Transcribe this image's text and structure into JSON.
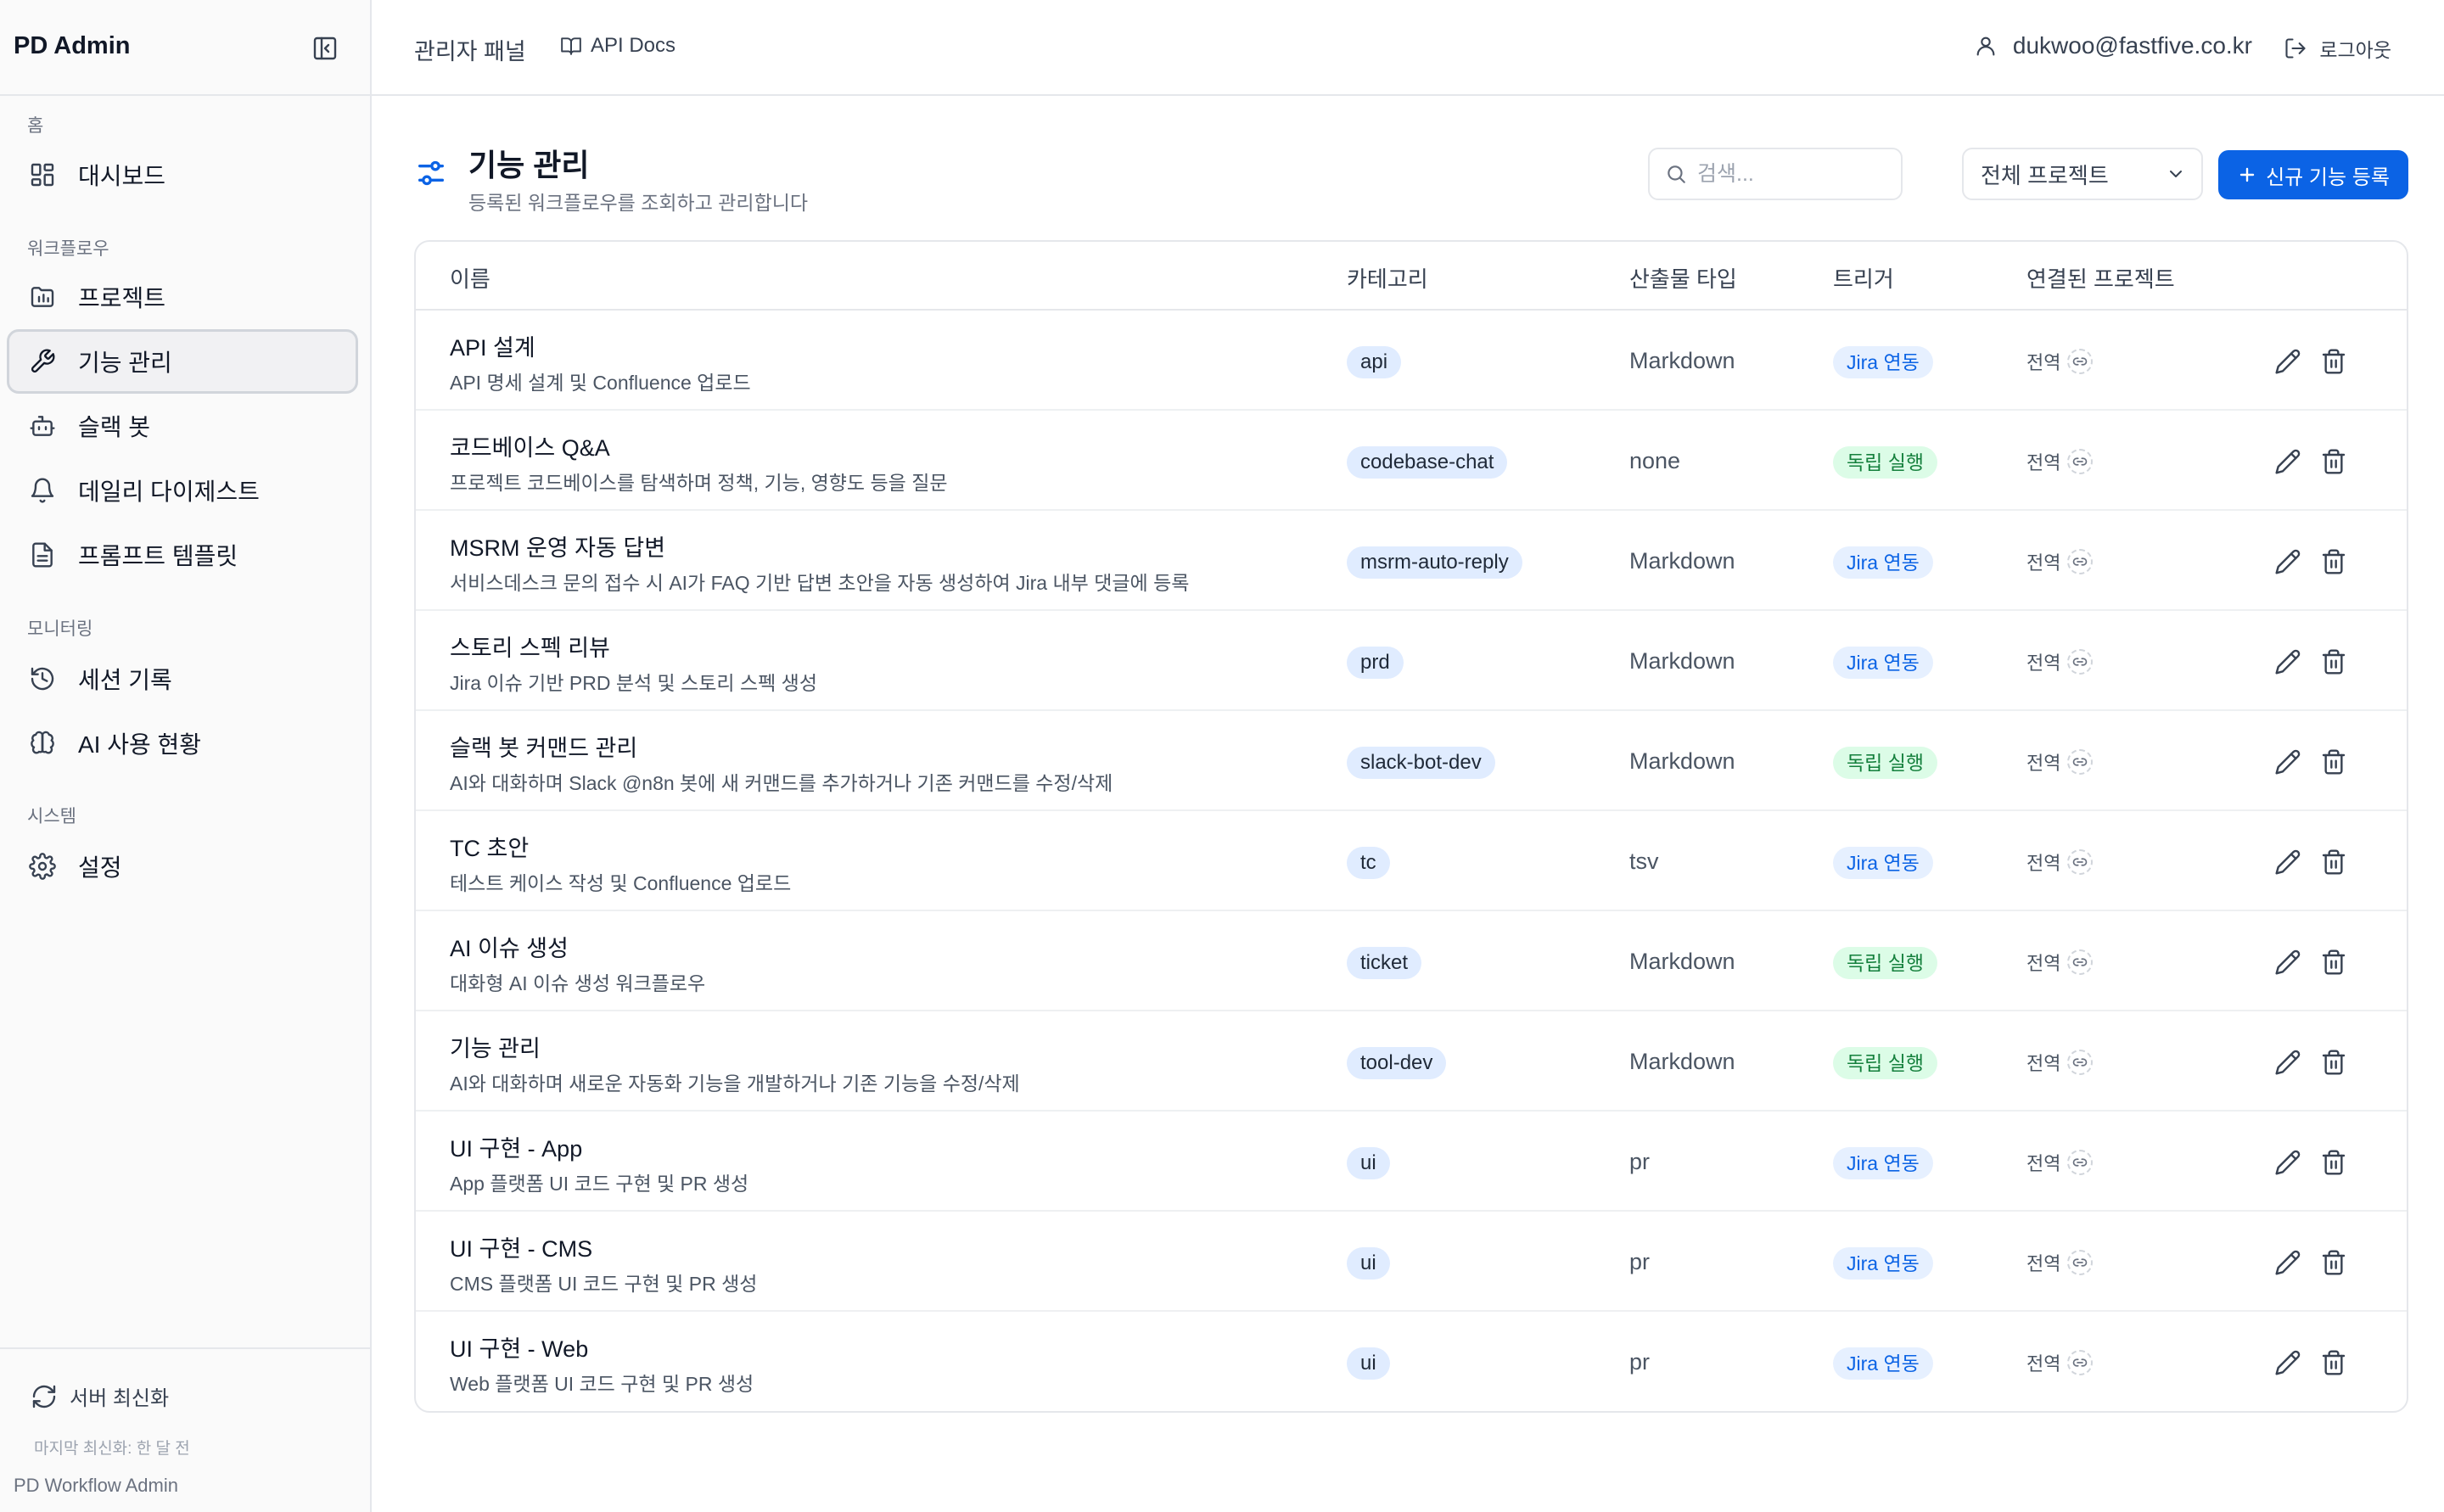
{
  "app": {
    "brand": "PD Admin",
    "footer_note": "PD Workflow Admin"
  },
  "topbar": {
    "admin_panel": "관리자 패널",
    "api_docs": "API Docs",
    "user_email": "dukwoo@fastfive.co.kr",
    "logout": "로그아웃"
  },
  "sidebar": {
    "sections": {
      "home": "홈",
      "workflow": "워크플로우",
      "monitoring": "모니터링",
      "system": "시스템"
    },
    "items": [
      {
        "label": "대시보드",
        "icon": "dashboard-icon"
      },
      {
        "label": "프로젝트",
        "icon": "folder-chart-icon"
      },
      {
        "label": "기능 관리",
        "icon": "wrench-icon",
        "active": true
      },
      {
        "label": "슬랙 봇",
        "icon": "bot-icon"
      },
      {
        "label": "데일리 다이제스트",
        "icon": "bell-icon"
      },
      {
        "label": "프롬프트 템플릿",
        "icon": "file-text-icon"
      },
      {
        "label": "세션 기록",
        "icon": "history-icon"
      },
      {
        "label": "AI 사용 현황",
        "icon": "brain-icon"
      },
      {
        "label": "설정",
        "icon": "gear-icon"
      }
    ],
    "refresh": {
      "label": "서버 최신화",
      "last": "마지막 최신화: 한 달 전"
    }
  },
  "page": {
    "title": "기능 관리",
    "subtitle": "등록된 워크플로우를 조회하고 관리합니다",
    "search_placeholder": "검색...",
    "project_filter": "전체 프로젝트",
    "new_button": "신규 기능 등록"
  },
  "table": {
    "headers": {
      "name": "이름",
      "category": "카테고리",
      "output_type": "산출물 타입",
      "trigger": "트리거",
      "projects": "연결된 프로젝트"
    },
    "rows": [
      {
        "name": "API 설계",
        "desc": "API 명세 설계 및 Confluence 업로드",
        "category": "api",
        "output": "Markdown",
        "trigger": "Jira 연동",
        "trigger_kind": "jira",
        "scope": "전역"
      },
      {
        "name": "코드베이스 Q&A",
        "desc": "프로젝트 코드베이스를 탐색하며 정책, 기능, 영향도 등을 질문",
        "category": "codebase-chat",
        "output": "none",
        "trigger": "독립 실행",
        "trigger_kind": "standalone",
        "scope": "전역"
      },
      {
        "name": "MSRM 운영 자동 답변",
        "desc": "서비스데스크 문의 접수 시 AI가 FAQ 기반 답변 초안을 자동 생성하여 Jira 내부 댓글에 등록",
        "category": "msrm-auto-reply",
        "output": "Markdown",
        "trigger": "Jira 연동",
        "trigger_kind": "jira",
        "scope": "전역"
      },
      {
        "name": "스토리 스펙 리뷰",
        "desc": "Jira 이슈 기반 PRD 분석 및 스토리 스펙 생성",
        "category": "prd",
        "output": "Markdown",
        "trigger": "Jira 연동",
        "trigger_kind": "jira",
        "scope": "전역"
      },
      {
        "name": "슬랙 봇 커맨드 관리",
        "desc": "AI와 대화하며 Slack @n8n 봇에 새 커맨드를 추가하거나 기존 커맨드를 수정/삭제",
        "category": "slack-bot-dev",
        "output": "Markdown",
        "trigger": "독립 실행",
        "trigger_kind": "standalone",
        "scope": "전역"
      },
      {
        "name": "TC 초안",
        "desc": "테스트 케이스 작성 및 Confluence 업로드",
        "category": "tc",
        "output": "tsv",
        "trigger": "Jira 연동",
        "trigger_kind": "jira",
        "scope": "전역"
      },
      {
        "name": "AI 이슈 생성",
        "desc": "대화형 AI 이슈 생성 워크플로우",
        "category": "ticket",
        "output": "Markdown",
        "trigger": "독립 실행",
        "trigger_kind": "standalone",
        "scope": "전역"
      },
      {
        "name": "기능 관리",
        "desc": "AI와 대화하며 새로운 자동화 기능을 개발하거나 기존 기능을 수정/삭제",
        "category": "tool-dev",
        "output": "Markdown",
        "trigger": "독립 실행",
        "trigger_kind": "standalone",
        "scope": "전역"
      },
      {
        "name": "UI 구현 - App",
        "desc": "App 플랫폼 UI 코드 구현 및 PR 생성",
        "category": "ui",
        "output": "pr",
        "trigger": "Jira 연동",
        "trigger_kind": "jira",
        "scope": "전역"
      },
      {
        "name": "UI 구현 - CMS",
        "desc": "CMS 플랫폼 UI 코드 구현 및 PR 생성",
        "category": "ui",
        "output": "pr",
        "trigger": "Jira 연동",
        "trigger_kind": "jira",
        "scope": "전역"
      },
      {
        "name": "UI 구현 - Web",
        "desc": "Web 플랫폼 UI 코드 구현 및 PR 생성",
        "category": "ui",
        "output": "pr",
        "trigger": "Jira 연동",
        "trigger_kind": "jira",
        "scope": "전역"
      }
    ]
  },
  "colors": {
    "primary": "#0b63e5",
    "jira_badge_bg": "#e6f0ff",
    "standalone_badge_bg": "#dcfce7",
    "standalone_text": "#15803d",
    "category_badge_bg": "#e0ecff"
  }
}
